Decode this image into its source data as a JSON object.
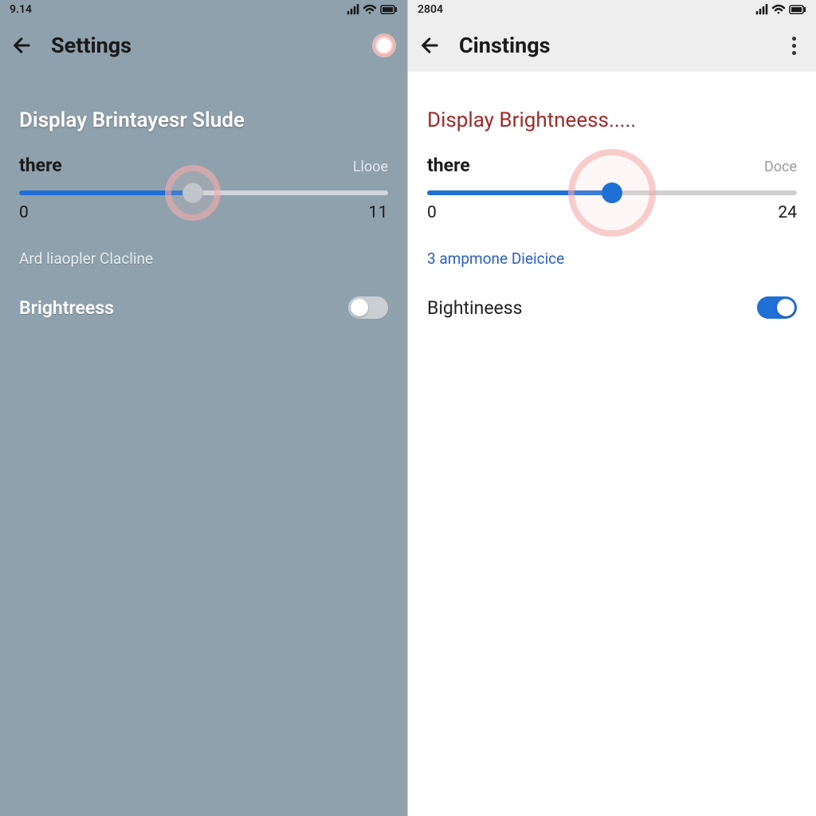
{
  "left": {
    "status_time": "9.14",
    "header_title": "Settings",
    "section_title": "Display Brintayesr Slude",
    "slider_label_left": "there",
    "slider_label_right": "Llooe",
    "slider_min": "0",
    "slider_max": "11",
    "slider_fill_pct": "47%",
    "subtext": "Ard liaopler Clacline",
    "toggle_label": "Brightreess",
    "toggle_on": false
  },
  "right": {
    "status_time": "2804",
    "header_title": "Cinstings",
    "section_title": "Display Brightneess.....",
    "slider_label_left": "there",
    "slider_label_right": "Doce",
    "slider_min": "0",
    "slider_max": "24",
    "slider_fill_pct": "50%",
    "subtext": "3 ampmone Dieicice",
    "toggle_label": "Bightineess",
    "toggle_on": true
  }
}
